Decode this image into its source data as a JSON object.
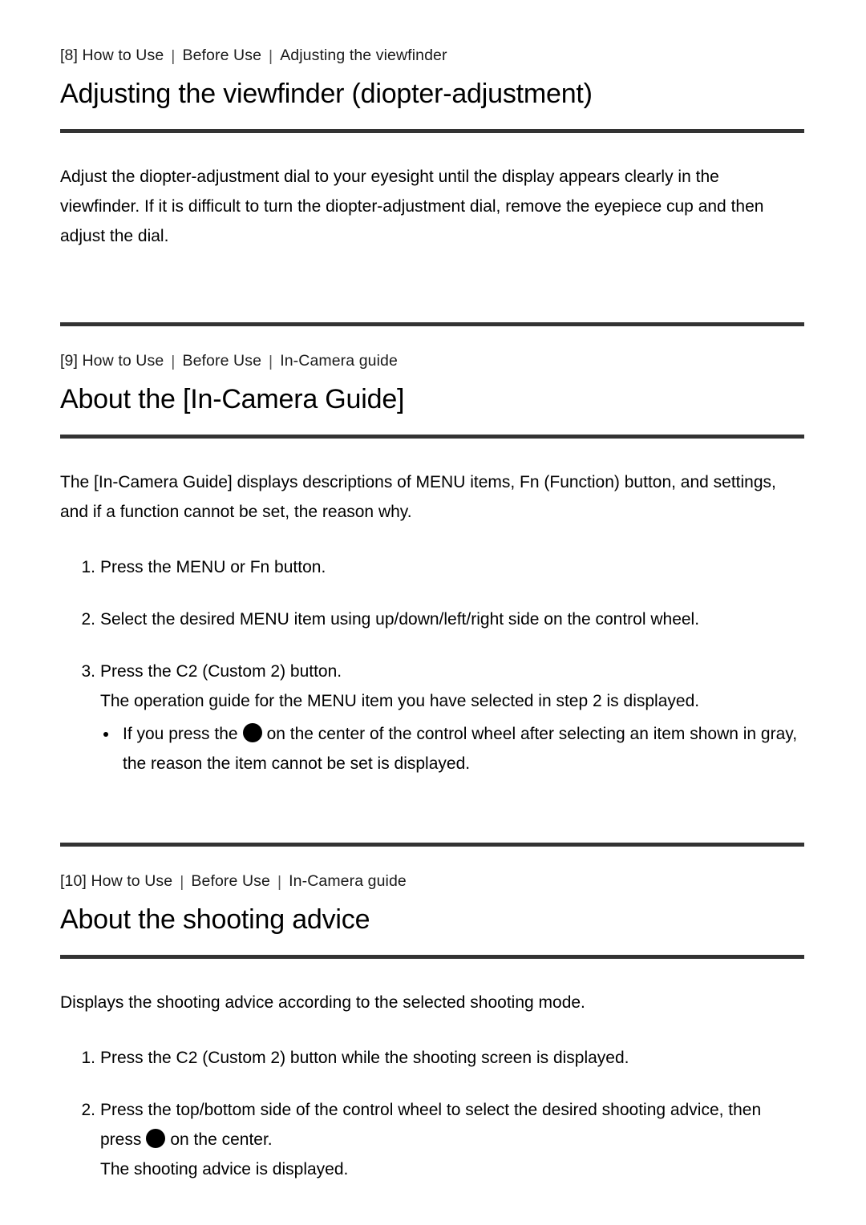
{
  "document": {
    "accent_rule_color": "#333333",
    "text_color": "#000000"
  },
  "sections": [
    {
      "breadcrumb": {
        "index": "[8] How to Use",
        "level2": "Before Use",
        "level3": "Adjusting the viewfinder",
        "separator": "|"
      },
      "title": "Adjusting the viewfinder (diopter-adjustment)",
      "paragraph": "Adjust the diopter-adjustment dial to your eyesight until the display appears clearly in the viewfinder. If it is difficult to turn the diopter-adjustment dial, remove the eyepiece cup and then adjust the dial."
    },
    {
      "breadcrumb": {
        "index": "[9] How to Use",
        "level2": "Before Use",
        "level3": "In-Camera guide",
        "separator": "|"
      },
      "title": "About the [In-Camera Guide]",
      "paragraph": "The [In-Camera Guide] displays descriptions of MENU items, Fn (Function) button, and settings, and if a function cannot be set, the reason why.",
      "steps": [
        {
          "num": "1.",
          "text": "Press the MENU or Fn button."
        },
        {
          "num": "2.",
          "text": "Select the desired MENU item using up/down/left/right side on the control wheel."
        },
        {
          "num": "3.",
          "text": "Press the C2 (Custom 2) button.",
          "note": "The operation guide for the MENU item you have selected in step 2 is displayed.",
          "bullet_before": "If you press the",
          "bullet_after": "on the center of the control wheel after selecting an item shown in gray, the reason the item cannot be set is displayed."
        }
      ]
    },
    {
      "breadcrumb": {
        "index": "[10] How to Use",
        "level2": "Before Use",
        "level3": "In-Camera guide",
        "separator": "|"
      },
      "title": "About the shooting advice",
      "paragraph": "Displays the shooting advice according to the selected shooting mode.",
      "steps": [
        {
          "num": "1.",
          "text": "Press the C2 (Custom 2) button while the shooting screen is displayed."
        },
        {
          "num": "2.",
          "text_before": "Press the top/bottom side of the control wheel to select the desired shooting advice, then press",
          "text_after": "on the center.",
          "note": "The shooting advice is displayed."
        }
      ]
    }
  ]
}
